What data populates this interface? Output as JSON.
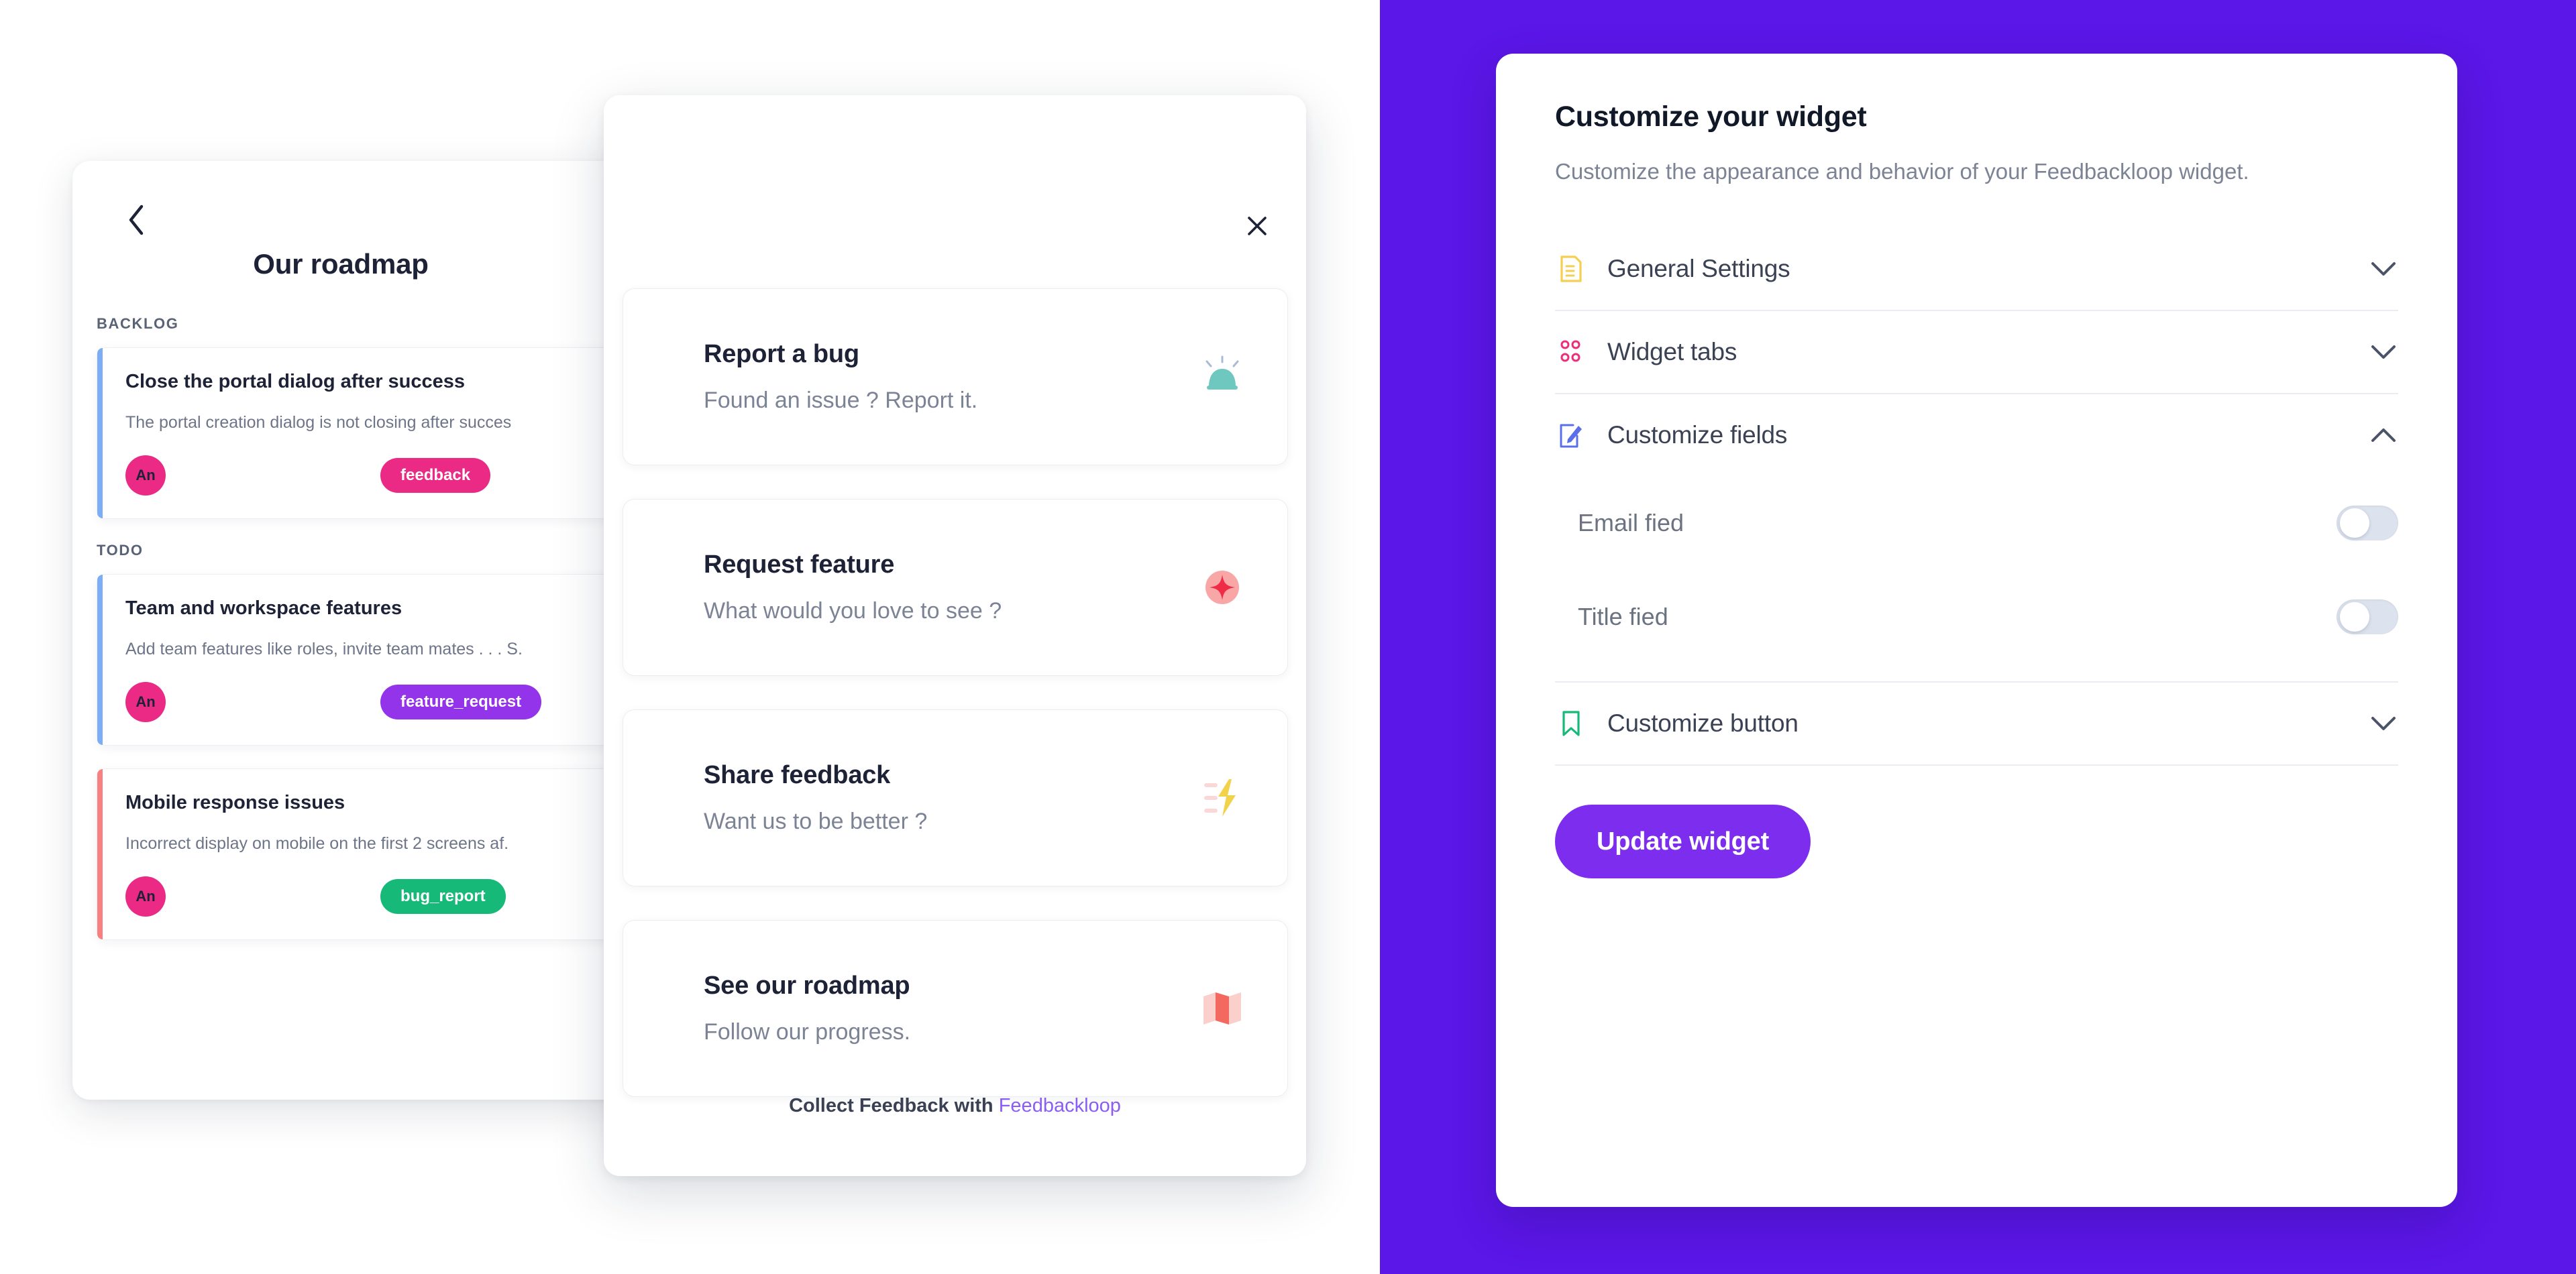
{
  "colors": {
    "brand_purple": "#5B16E8",
    "button_purple": "#7C2DEE",
    "brand_link": "#8B5CF6",
    "tag_feedback": "#EA2A85",
    "tag_feature_request": "#9333EA",
    "tag_bug_report": "#17B978",
    "accent_backlog": "#7DAEF5",
    "accent_bug": "#F98080",
    "avatar_bg": "#EA2A85"
  },
  "roadmap": {
    "back_icon": "chevron-left-icon",
    "title": "Our roadmap",
    "groups": [
      {
        "label": "BACKLOG",
        "cards": [
          {
            "title": "Close the portal dialog after success",
            "description": "The portal creation dialog is not closing after succes",
            "avatar": "An",
            "tag": "feedback",
            "tag_class": "t-feedback",
            "accent": "accent-blue"
          }
        ]
      },
      {
        "label": "TODO",
        "cards": [
          {
            "title": "Team and workspace features",
            "description": "Add team features like roles, invite team mates . . . S.",
            "avatar": "An",
            "tag": "feature_request",
            "tag_class": "t-feature",
            "accent": "accent-blue"
          },
          {
            "title": "Mobile response issues",
            "description": "Incorrect display on mobile on the first 2 screens af.",
            "avatar": "An",
            "tag": "bug_report",
            "tag_class": "t-bug",
            "accent": "accent-red"
          }
        ]
      }
    ]
  },
  "widget_modal": {
    "close_icon": "close-icon",
    "items": [
      {
        "title": "Report a bug",
        "subtitle": "Found an issue ? Report it.",
        "icon": "siren-alarm-icon"
      },
      {
        "title": "Request feature",
        "subtitle": "What would you love to see ?",
        "icon": "sparkle-star-icon"
      },
      {
        "title": "Share feedback",
        "subtitle": "Want us to be better ?",
        "icon": "feedback-lightning-icon"
      },
      {
        "title": "See our roadmap",
        "subtitle": "Follow our progress.",
        "icon": "folded-map-icon"
      }
    ],
    "footer_text": "Collect Feedback with",
    "footer_brand": "Feedbackloop"
  },
  "config_panel": {
    "title": "Customize your widget",
    "subtitle": "Customize the appearance and behavior of your Feedbackloop widget.",
    "sections": [
      {
        "label": "General Settings",
        "icon": "document-icon",
        "state": "collapsed",
        "chevron": "chevron-down-icon"
      },
      {
        "label": "Widget tabs",
        "icon": "grid-dots-icon",
        "state": "collapsed",
        "chevron": "chevron-down-icon"
      },
      {
        "label": "Customize fields",
        "icon": "pencil-edit-icon",
        "state": "expanded",
        "chevron": "chevron-up-icon",
        "fields": [
          {
            "label": "Email fied",
            "toggle": "off"
          },
          {
            "label": "Title fied",
            "toggle": "off"
          }
        ]
      },
      {
        "label": "Customize button",
        "icon": "bookmark-icon",
        "state": "collapsed",
        "chevron": "chevron-down-icon"
      }
    ],
    "update_button": "Update widget"
  }
}
